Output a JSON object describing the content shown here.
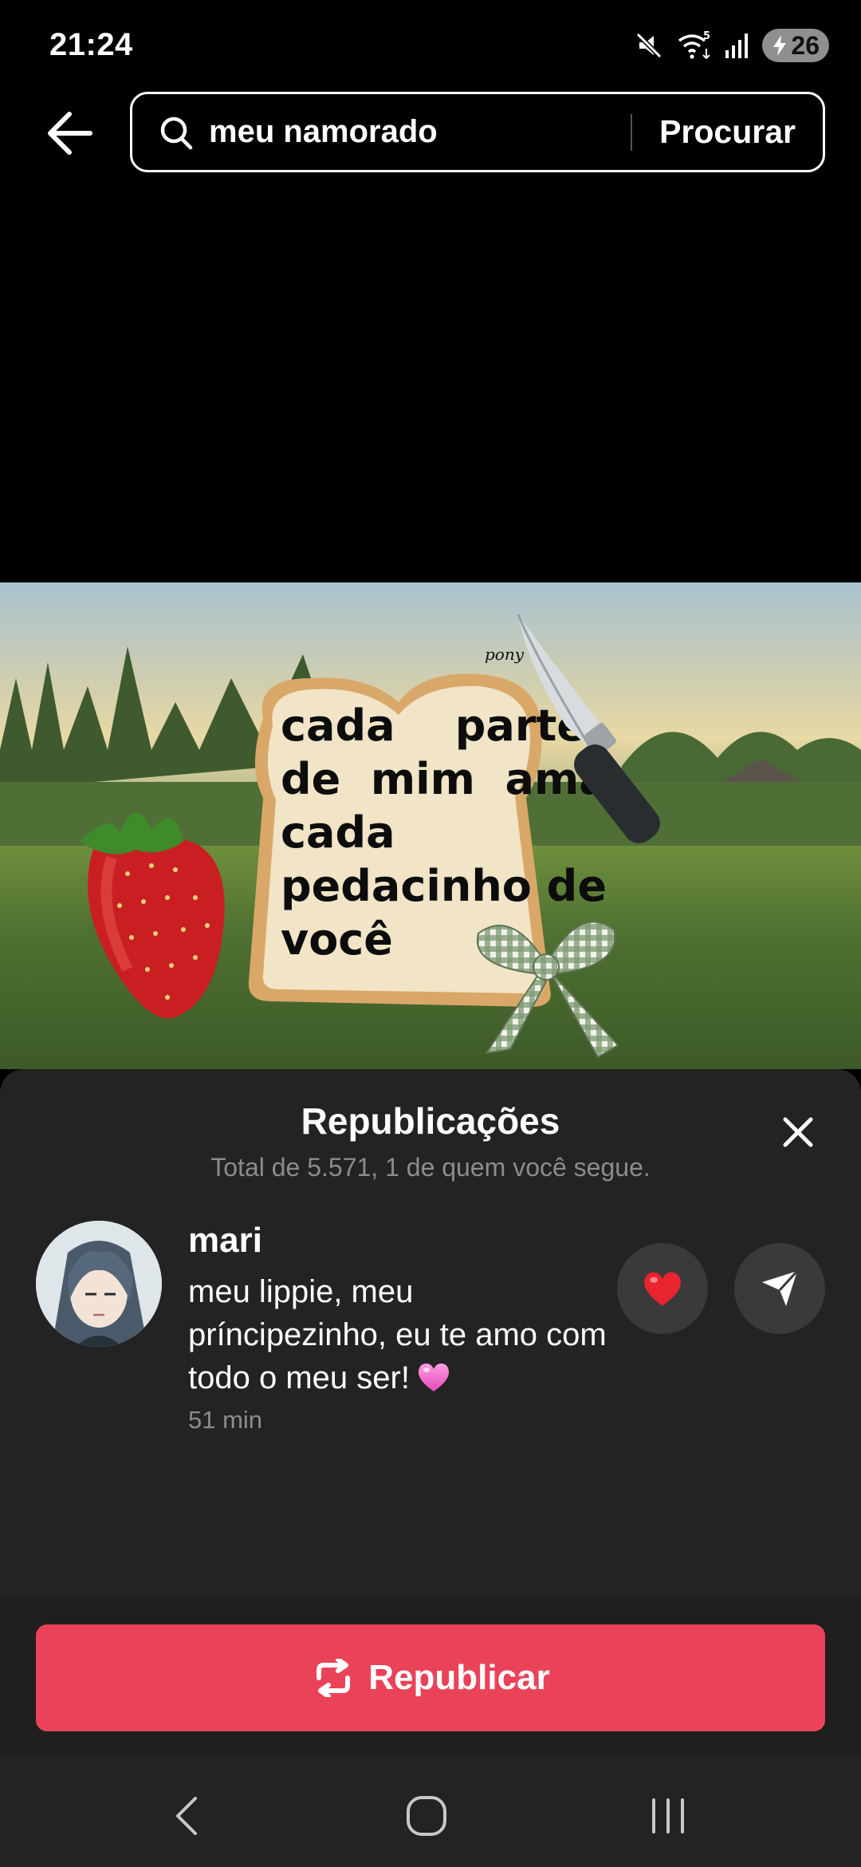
{
  "status_bar": {
    "time": "21:24",
    "network_badge": "5",
    "battery_level": "26",
    "icons": [
      "mute-icon",
      "wifi-icon",
      "signal-icon",
      "battery-charging-icon"
    ]
  },
  "header": {
    "back_icon": "arrow-left-icon",
    "search_icon": "search-icon",
    "query": "meu namorado",
    "submit_label": "Procurar"
  },
  "video": {
    "bread_text": "cada    parte\nde  mim  ama\ncada\npedacinho de\nvocê",
    "watermark": "pony"
  },
  "sheet": {
    "title": "Republicações",
    "subtitle": "Total de 5.571, 1 de quem você segue.",
    "close_icon": "close-icon",
    "reposts": [
      {
        "user": "mari",
        "comment": "meu lippie, meu príncipezinho, eu te amo com todo o meu ser!",
        "emoji": "pink-heart-icon",
        "time": "51 min",
        "like_icon": "red-heart-icon",
        "send_icon": "send-icon"
      }
    ],
    "repost_button_label": "Republicar",
    "repost_icon": "repost-icon"
  },
  "nav": {
    "icons": [
      "nav-back-icon",
      "nav-home-icon",
      "nav-recents-icon"
    ]
  },
  "colors": {
    "accent": "#ea4359",
    "sheet_bg": "#232323",
    "muted_text": "#8c8c8c"
  }
}
